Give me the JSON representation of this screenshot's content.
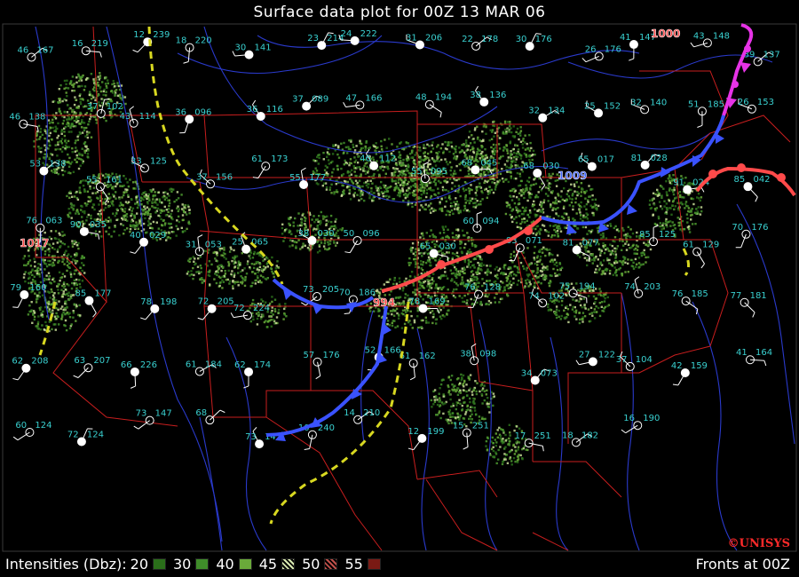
{
  "title": "Surface data plot for 00Z 13 MAR 06",
  "legend": {
    "label": "Intensities (Dbz):",
    "levels": [
      {
        "value": "20",
        "color": "#2a6e1a"
      },
      {
        "value": "30",
        "color": "#3f8c2a"
      },
      {
        "value": "40",
        "color": "#6aaa3a"
      },
      {
        "value": "45",
        "color": "#d8e8b0"
      },
      {
        "value": "50",
        "color": "#c0504a"
      },
      {
        "value": "55",
        "color": "#7a1a14"
      }
    ]
  },
  "fronts_label": "Fronts at 00Z",
  "logo": "©UNISYS",
  "pressure_labels": [
    {
      "text": "1000",
      "color": "#ff4444"
    },
    {
      "text": "1017",
      "color": "#ff4444"
    },
    {
      "text": "1009",
      "color": "#4466ff"
    },
    {
      "text": "994",
      "color": "#ff4444"
    }
  ],
  "colors": {
    "background": "#000000",
    "state_borders": "#c81e1e",
    "isobars": "#2a3acc",
    "station_text": "#39d0d0",
    "cold_front": "#3a52ff",
    "warm_front": "#ff4a4a",
    "occluded_front": "#e633e6",
    "trough": "#d8d820"
  },
  "stations": [
    {
      "t": "46",
      "p": "167"
    },
    {
      "t": "16",
      "p": "219"
    },
    {
      "t": "12",
      "p": "239"
    },
    {
      "t": "18",
      "p": "220"
    },
    {
      "t": "30",
      "p": "141"
    },
    {
      "t": "23",
      "p": "214"
    },
    {
      "t": "24",
      "p": "222"
    },
    {
      "t": "31",
      "p": "206"
    },
    {
      "t": "22",
      "p": "178"
    },
    {
      "t": "30",
      "p": "176"
    },
    {
      "t": "26",
      "p": "176"
    },
    {
      "t": "41",
      "p": "147"
    },
    {
      "t": "43",
      "p": "148"
    },
    {
      "t": "39",
      "p": "137"
    },
    {
      "t": "46",
      "p": "138"
    },
    {
      "t": "37",
      "p": "102"
    },
    {
      "t": "43",
      "p": "114"
    },
    {
      "t": "36",
      "p": "096"
    },
    {
      "t": "36",
      "p": "116"
    },
    {
      "t": "37",
      "p": "089"
    },
    {
      "t": "47",
      "p": "166"
    },
    {
      "t": "48",
      "p": "194"
    },
    {
      "t": "38",
      "p": "136"
    },
    {
      "t": "32",
      "p": "134"
    },
    {
      "t": "25",
      "p": "152"
    },
    {
      "t": "32",
      "p": "140"
    },
    {
      "t": "51",
      "p": "185"
    },
    {
      "t": "26",
      "p": "153"
    },
    {
      "t": "53",
      "p": "138"
    },
    {
      "t": "55",
      "p": "161"
    },
    {
      "t": "33",
      "p": "125"
    },
    {
      "t": "37",
      "p": "156"
    },
    {
      "t": "61",
      "p": "173"
    },
    {
      "t": "55",
      "p": "177"
    },
    {
      "t": "46",
      "p": "112"
    },
    {
      "t": "55",
      "p": "095"
    },
    {
      "t": "68",
      "p": "045"
    },
    {
      "t": "68",
      "p": "030"
    },
    {
      "t": "65",
      "p": "017"
    },
    {
      "t": "81",
      "p": "028"
    },
    {
      "t": "91",
      "p": "024"
    },
    {
      "t": "85",
      "p": "042"
    },
    {
      "t": "76",
      "p": "063"
    },
    {
      "t": "90",
      "p": "035"
    },
    {
      "t": "40",
      "p": "029"
    },
    {
      "t": "31",
      "p": "053"
    },
    {
      "t": "25",
      "p": "065"
    },
    {
      "t": "38",
      "p": "030"
    },
    {
      "t": "50",
      "p": "096"
    },
    {
      "t": "65",
      "p": "030"
    },
    {
      "t": "60",
      "p": "094"
    },
    {
      "t": "83",
      "p": "071"
    },
    {
      "t": "81",
      "p": "077"
    },
    {
      "t": "85",
      "p": "125"
    },
    {
      "t": "61",
      "p": "129"
    },
    {
      "t": "70",
      "p": "176"
    },
    {
      "t": "79",
      "p": "160"
    },
    {
      "t": "85",
      "p": "177"
    },
    {
      "t": "78",
      "p": "198"
    },
    {
      "t": "72",
      "p": "205"
    },
    {
      "t": "72",
      "p": "224"
    },
    {
      "t": "73",
      "p": "205"
    },
    {
      "t": "70",
      "p": "186"
    },
    {
      "t": "78",
      "p": "169"
    },
    {
      "t": "76",
      "p": "128"
    },
    {
      "t": "74",
      "p": "102"
    },
    {
      "t": "75",
      "p": "194"
    },
    {
      "t": "74",
      "p": "203"
    },
    {
      "t": "76",
      "p": "185"
    },
    {
      "t": "77",
      "p": "181"
    },
    {
      "t": "62",
      "p": "208"
    },
    {
      "t": "63",
      "p": "207"
    },
    {
      "t": "66",
      "p": "226"
    },
    {
      "t": "61",
      "p": "184"
    },
    {
      "t": "62",
      "p": "174"
    },
    {
      "t": "57",
      "p": "176"
    },
    {
      "t": "52",
      "p": "166"
    },
    {
      "t": "61",
      "p": "162"
    },
    {
      "t": "38",
      "p": "098"
    },
    {
      "t": "34",
      "p": "073"
    },
    {
      "t": "27",
      "p": "122"
    },
    {
      "t": "37",
      "p": "104"
    },
    {
      "t": "42",
      "p": "159"
    },
    {
      "t": "41",
      "p": "164"
    },
    {
      "t": "60",
      "p": "124"
    },
    {
      "t": "72",
      "p": "124"
    },
    {
      "t": "73",
      "p": "147"
    },
    {
      "t": "68",
      "p": ""
    },
    {
      "t": "73",
      "p": "147"
    },
    {
      "t": "10",
      "p": "240"
    },
    {
      "t": "14",
      "p": "210"
    },
    {
      "t": "12",
      "p": "199"
    },
    {
      "t": "15",
      "p": "251"
    },
    {
      "t": "17",
      "p": "251"
    },
    {
      "t": "18",
      "p": "182"
    },
    {
      "t": "16",
      "p": "190"
    }
  ]
}
